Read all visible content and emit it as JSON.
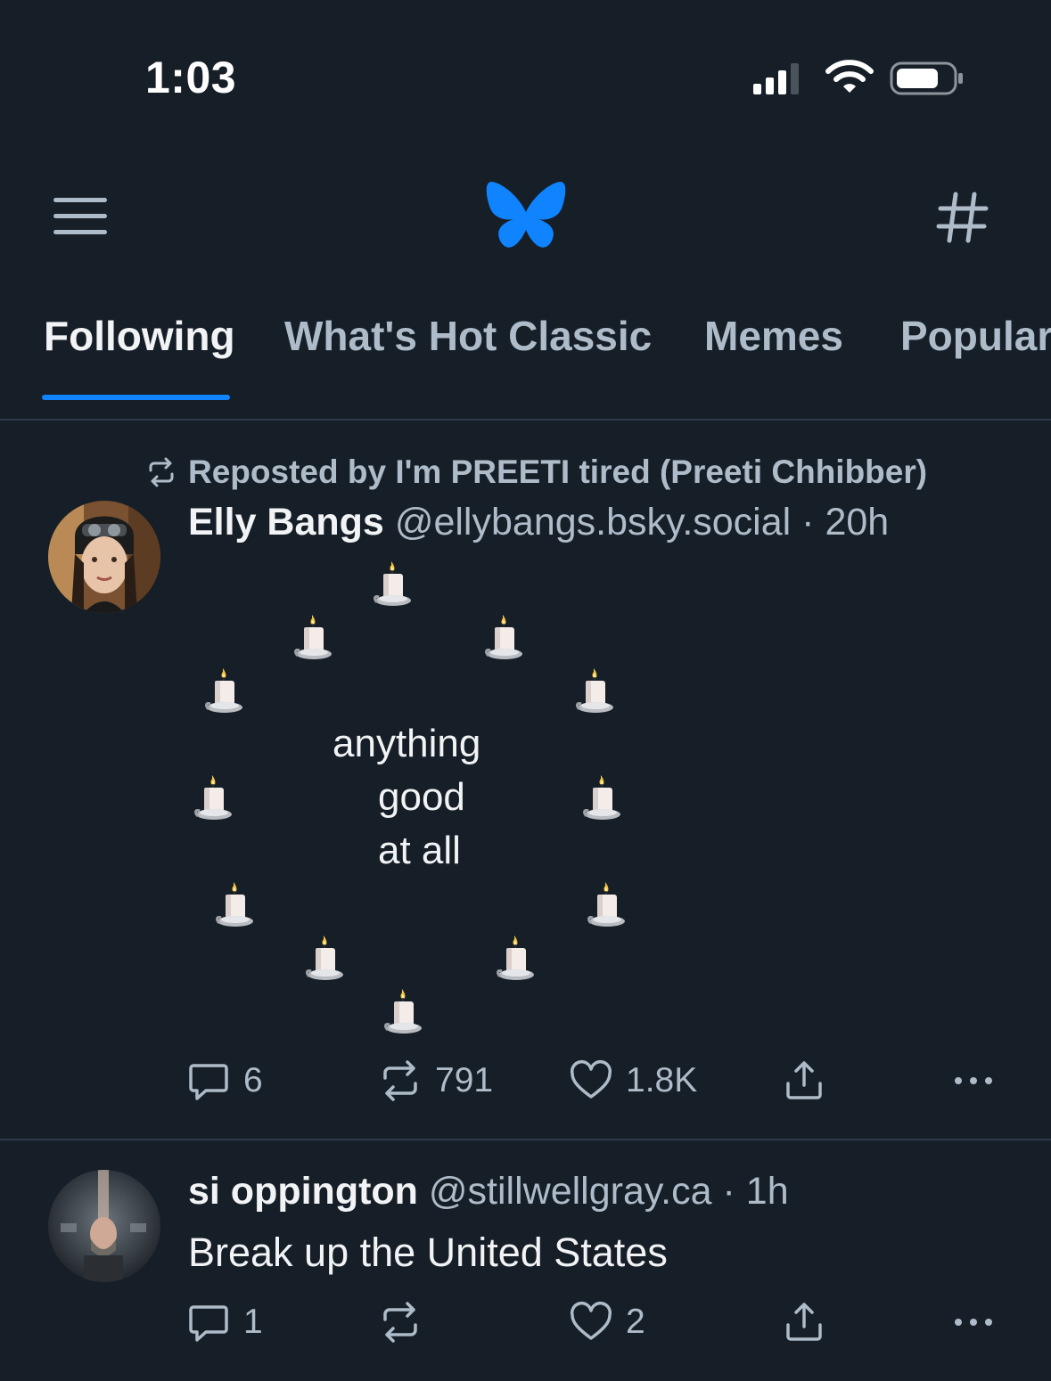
{
  "status_bar": {
    "time": "1:03"
  },
  "header": {
    "logo": "butterfly-logo-icon",
    "menu": "hamburger-icon",
    "feeds": "hashtag-icon",
    "accent": "#1083fe"
  },
  "tabs": [
    {
      "label": "Following",
      "active": true
    },
    {
      "label": "What's Hot Classic",
      "active": false
    },
    {
      "label": "Memes",
      "active": false
    },
    {
      "label": "Popular",
      "active": false
    }
  ],
  "posts": [
    {
      "repost_label": "Reposted by I'm PREETI tired (Preeti Chhibber)",
      "author": "Elly Bangs",
      "handle": "@ellybangs.bsky.social",
      "separator": "·",
      "time": "20h",
      "text_lines": [
        "anything",
        "good",
        "at all"
      ],
      "emoji": "candle",
      "replies": "6",
      "reposts": "791",
      "likes": "1.8K"
    },
    {
      "author": "si oppington",
      "handle": "@stillwellgray.ca",
      "separator": "·",
      "time": "1h",
      "text": "Break up the United States",
      "replies": "1",
      "reposts": "",
      "likes": "2"
    }
  ]
}
